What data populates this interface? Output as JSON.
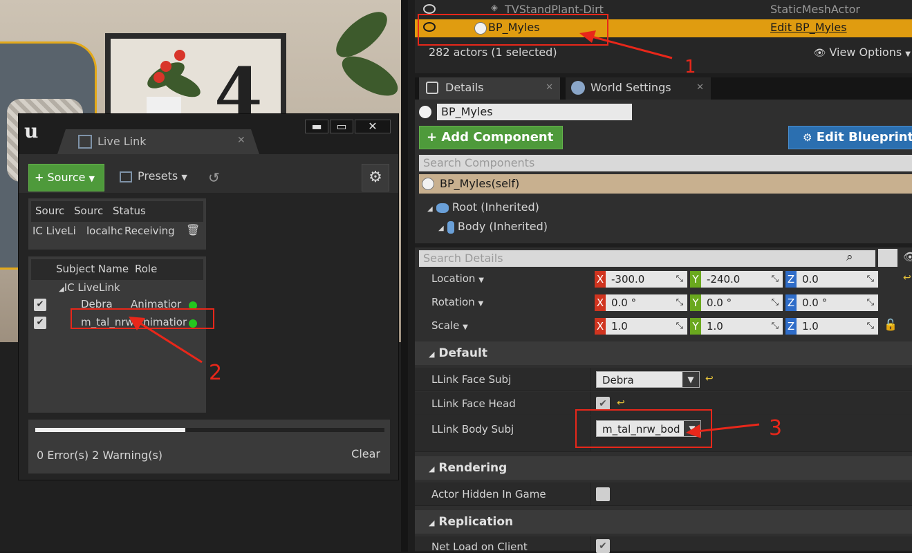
{
  "outliner": {
    "row_prev_name": "TVStandPlant-Dirt",
    "row_prev_type": "StaticMeshActor",
    "row_sel_name": "BP_Myles",
    "row_sel_type": "Edit BP_Myles",
    "actor_count": "282 actors (1 selected)",
    "view_options": "View Options"
  },
  "tabs": {
    "details": "Details",
    "world_settings": "World Settings"
  },
  "details": {
    "name": "BP_Myles",
    "add_component": "+ Add Component",
    "edit_blueprint": "Edit Blueprint",
    "search_components": "Search Components",
    "self_row": "BP_Myles(self)",
    "root": "Root (Inherited)",
    "body": "Body (Inherited)",
    "search_details": "Search Details",
    "transform": {
      "location": {
        "label": "Location",
        "x": "-300.0",
        "y": "-240.0",
        "z": "0.0"
      },
      "rotation": {
        "label": "Rotation",
        "x": "0.0 °",
        "y": "0.0 °",
        "z": "0.0 °"
      },
      "scale": {
        "label": "Scale",
        "x": "1.0",
        "y": "1.0",
        "z": "1.0"
      }
    },
    "axis": {
      "x": "X",
      "y": "Y",
      "z": "Z"
    },
    "sections": {
      "default": "Default",
      "rendering": "Rendering",
      "replication": "Replication"
    },
    "props": {
      "face_subj_label": "LLink Face Subj",
      "face_subj_value": "Debra",
      "face_head_label": "LLink Face Head",
      "body_subj_label": "LLink Body Subj",
      "body_subj_value": "m_tal_nrw_bod",
      "actor_hidden_label": "Actor Hidden In Game",
      "net_load_label": "Net Load on Client"
    }
  },
  "livelink": {
    "tab_label": "Live Link",
    "source_btn": "Source",
    "presets_btn": "Presets",
    "sources_header": [
      "Sourc",
      "Sourc",
      "Status"
    ],
    "source_row": {
      "type": "IC LiveLi",
      "machine": "localhc",
      "status": "Receiving"
    },
    "subjects_header": [
      "Subject Name",
      "Role"
    ],
    "group": "IC LiveLink",
    "subjects": [
      {
        "name": "Debra",
        "role": "Animatior"
      },
      {
        "name": "m_tal_nrw",
        "role": "Animatior"
      }
    ],
    "progress": 0.43,
    "errors_text": "0 Error(s)  2 Warning(s)",
    "clear_btn": "Clear"
  },
  "annotations": {
    "one": "1",
    "two": "2",
    "three": "3"
  },
  "colors": {
    "selected": "#e09c10",
    "green": "#4e9a3b",
    "blue": "#2b6fb0",
    "annotation": "#e8271a"
  }
}
